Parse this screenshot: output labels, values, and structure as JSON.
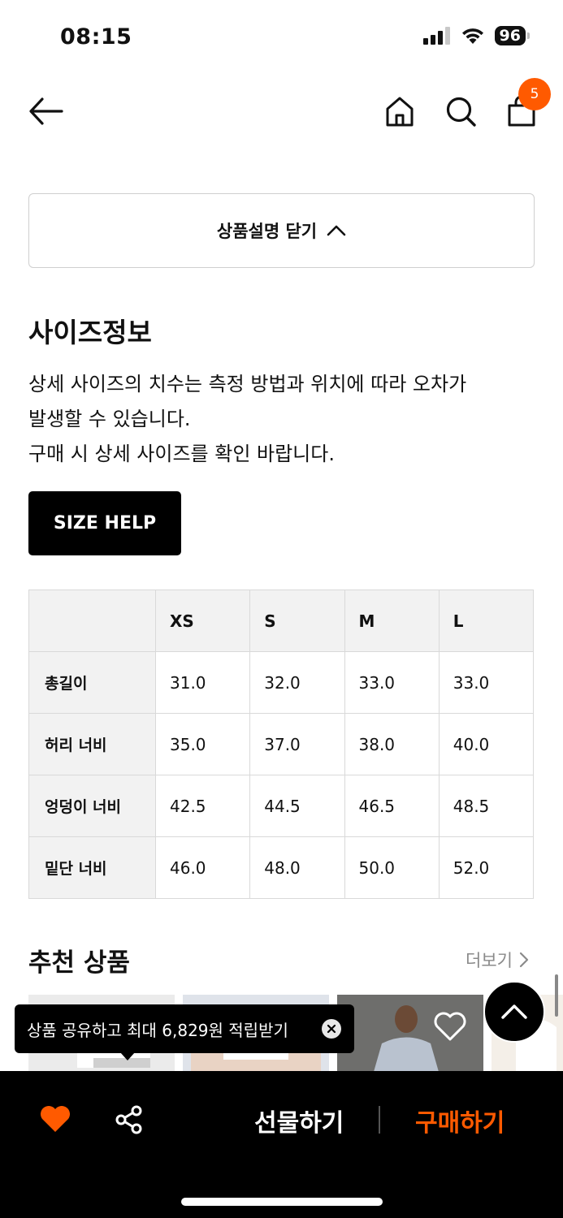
{
  "status_bar": {
    "time": "08:15",
    "battery": "96"
  },
  "nav": {
    "cart_count": "5"
  },
  "collapse_button": {
    "label": "상품설명 닫기"
  },
  "size_info": {
    "title": "사이즈정보",
    "desc_line1": "상세 사이즈의 치수는 측정 방법과 위치에 따라 오차가",
    "desc_line2": "발생할 수 있습니다.",
    "desc_line3": "구매 시 상세 사이즈를 확인 바랍니다.",
    "size_help_label": "SIZE HELP"
  },
  "size_table": {
    "columns": [
      "XS",
      "S",
      "M",
      "L"
    ],
    "rows": [
      {
        "label": "총길이",
        "values": [
          "31.0",
          "32.0",
          "33.0",
          "33.0"
        ]
      },
      {
        "label": "허리 너비",
        "values": [
          "35.0",
          "37.0",
          "38.0",
          "40.0"
        ]
      },
      {
        "label": "엉덩이 너비",
        "values": [
          "42.5",
          "44.5",
          "46.5",
          "48.5"
        ]
      },
      {
        "label": "밑단 너비",
        "values": [
          "46.0",
          "48.0",
          "50.0",
          "52.0"
        ]
      }
    ]
  },
  "recommended": {
    "title": "추천 상품",
    "more_label": "더보기"
  },
  "tooltip": {
    "text": "상품 공유하고 최대 6,829원 적립받기"
  },
  "bottom_bar": {
    "gift_label": "선물하기",
    "buy_label": "구매하기"
  },
  "colors": {
    "accent": "#ff5a00",
    "black": "#000000"
  }
}
